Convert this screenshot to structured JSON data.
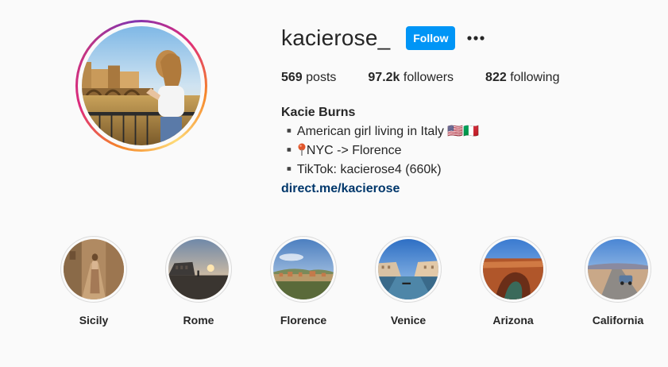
{
  "profile": {
    "username": "kacierose_",
    "follow_label": "Follow",
    "more_icon": "more-horizontal-icon",
    "stats": {
      "posts_count": "569",
      "posts_label": "posts",
      "followers_count": "97.2k",
      "followers_label": "followers",
      "following_count": "822",
      "following_label": "following"
    },
    "bio": {
      "name": "Kacie Burns",
      "line1": "▪️American girl living in Italy 🇺🇸🇮🇹",
      "line2_prefix": "▪️",
      "line2_text": "NYC -> Florence",
      "line3": "▪️TikTok: kacierose4 (660k)",
      "link": "direct.me/kacierose"
    }
  },
  "highlights": [
    {
      "label": "Sicily"
    },
    {
      "label": "Rome"
    },
    {
      "label": "Florence"
    },
    {
      "label": "Venice"
    },
    {
      "label": "Arizona"
    },
    {
      "label": "California"
    }
  ],
  "colors": {
    "accent": "#0095f6",
    "link": "#00376b",
    "text": "#262626",
    "background": "#fafafa"
  }
}
